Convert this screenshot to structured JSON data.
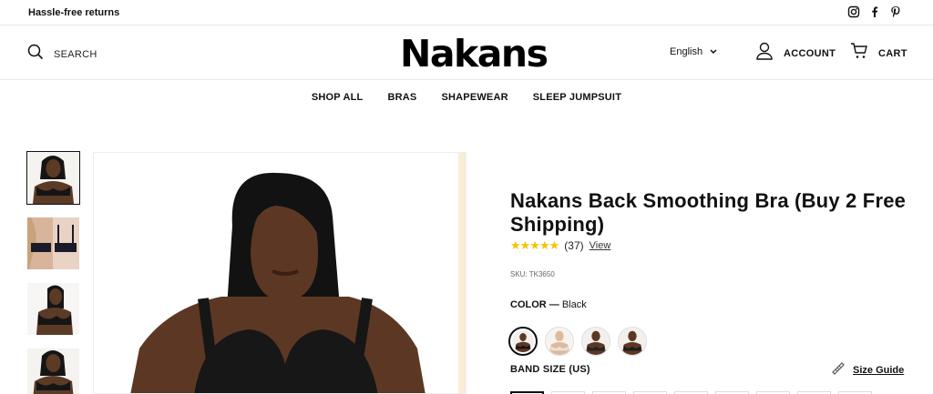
{
  "topbar": {
    "promo": "Hassle-free returns",
    "social": [
      "instagram-icon",
      "facebook-icon",
      "pinterest-icon"
    ]
  },
  "header": {
    "search_label": "SEARCH",
    "logo": "Nakans",
    "language": "English",
    "account_label": "ACCOUNT",
    "cart_label": "CART"
  },
  "nav": {
    "items": [
      "SHOP ALL",
      "BRAS",
      "SHAPEWEAR",
      "SLEEP JUMPSUIT"
    ]
  },
  "product": {
    "title": "Nakans Back Smoothing Bra (Buy 2 Free Shipping)",
    "stars": "★★★★★",
    "rating": 5,
    "review_count": "(37)",
    "view_label": "View",
    "sku": "SKU: TK3650",
    "color_label": "COLOR —",
    "color_value": "Black",
    "band_size_label": "BAND SIZE (US)",
    "size_guide_label": "Size Guide"
  },
  "colors": {
    "accent_star": "#f4c400",
    "text": "#111111",
    "border": "#e8e8e8"
  }
}
